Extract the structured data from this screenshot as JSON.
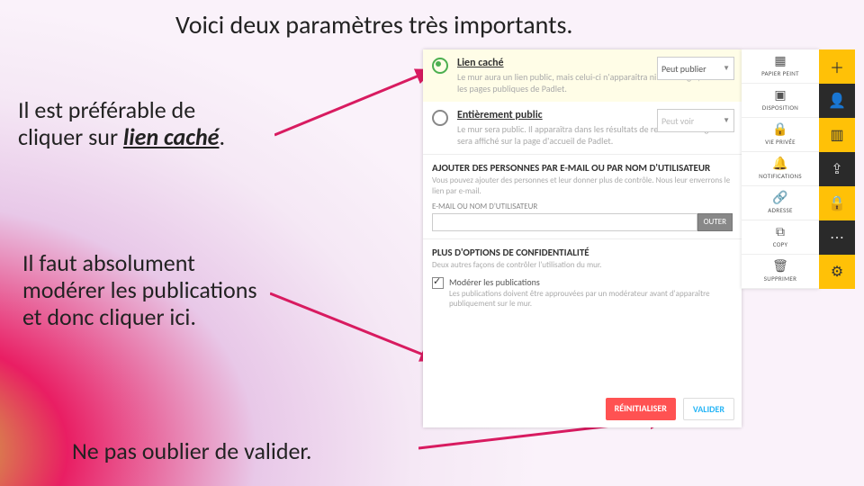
{
  "title": "Voici deux paramètres très importants.",
  "notes": {
    "n1a": "Il est préférable de",
    "n1b": "cliquer sur ",
    "n1c": "lien caché",
    "n1d": ".",
    "n2a": "Il faut absolument",
    "n2b": "modérer les publications",
    "n2c": "et donc cliquer ici.",
    "n3": "Ne pas oublier de valider."
  },
  "opt1": {
    "title": "Lien caché",
    "desc": "Le mur aura un lien public, mais celui-ci n'apparaîtra ni sur Google, ni sur les pages publiques de Padlet.",
    "dd": "Peut publier"
  },
  "opt2": {
    "title": "Entièrement public",
    "desc": "Le mur sera public. Il apparaîtra dans les résultats de recherche Google et sera affiché sur la page d'accueil de Padlet.",
    "dd": "Peut voir"
  },
  "add": {
    "title": "AJOUTER DES PERSONNES PAR E-MAIL OU PAR NOM D'UTILISATEUR",
    "desc": "Vous pouvez ajouter des personnes et leur donner plus de contrôle. Nous leur enverrons le lien par e-mail.",
    "field": "E-MAIL OU NOM D'UTILISATEUR",
    "btn": "OUTER"
  },
  "priv": {
    "title": "PLUS D'OPTIONS DE CONFIDENTIALITÉ",
    "desc": "Deux autres façons de contrôler l'utilisation du mur.",
    "sub_t": "Modérer les publications",
    "sub_d": "Les publications doivent être approuvées par un modérateur avant d'apparaître publiquement sur le mur."
  },
  "btns": {
    "reset": "RÉINITIALISER",
    "valid": "VALIDER"
  },
  "side": {
    "s1": "PAPIER PEINT",
    "s2": "DISPOSITION",
    "s3": "VIE PRIVÉE",
    "s4": "NOTIFICATIONS",
    "s5": "ADRESSE",
    "s6": "COPY",
    "s7": "SUPPRIMER"
  }
}
